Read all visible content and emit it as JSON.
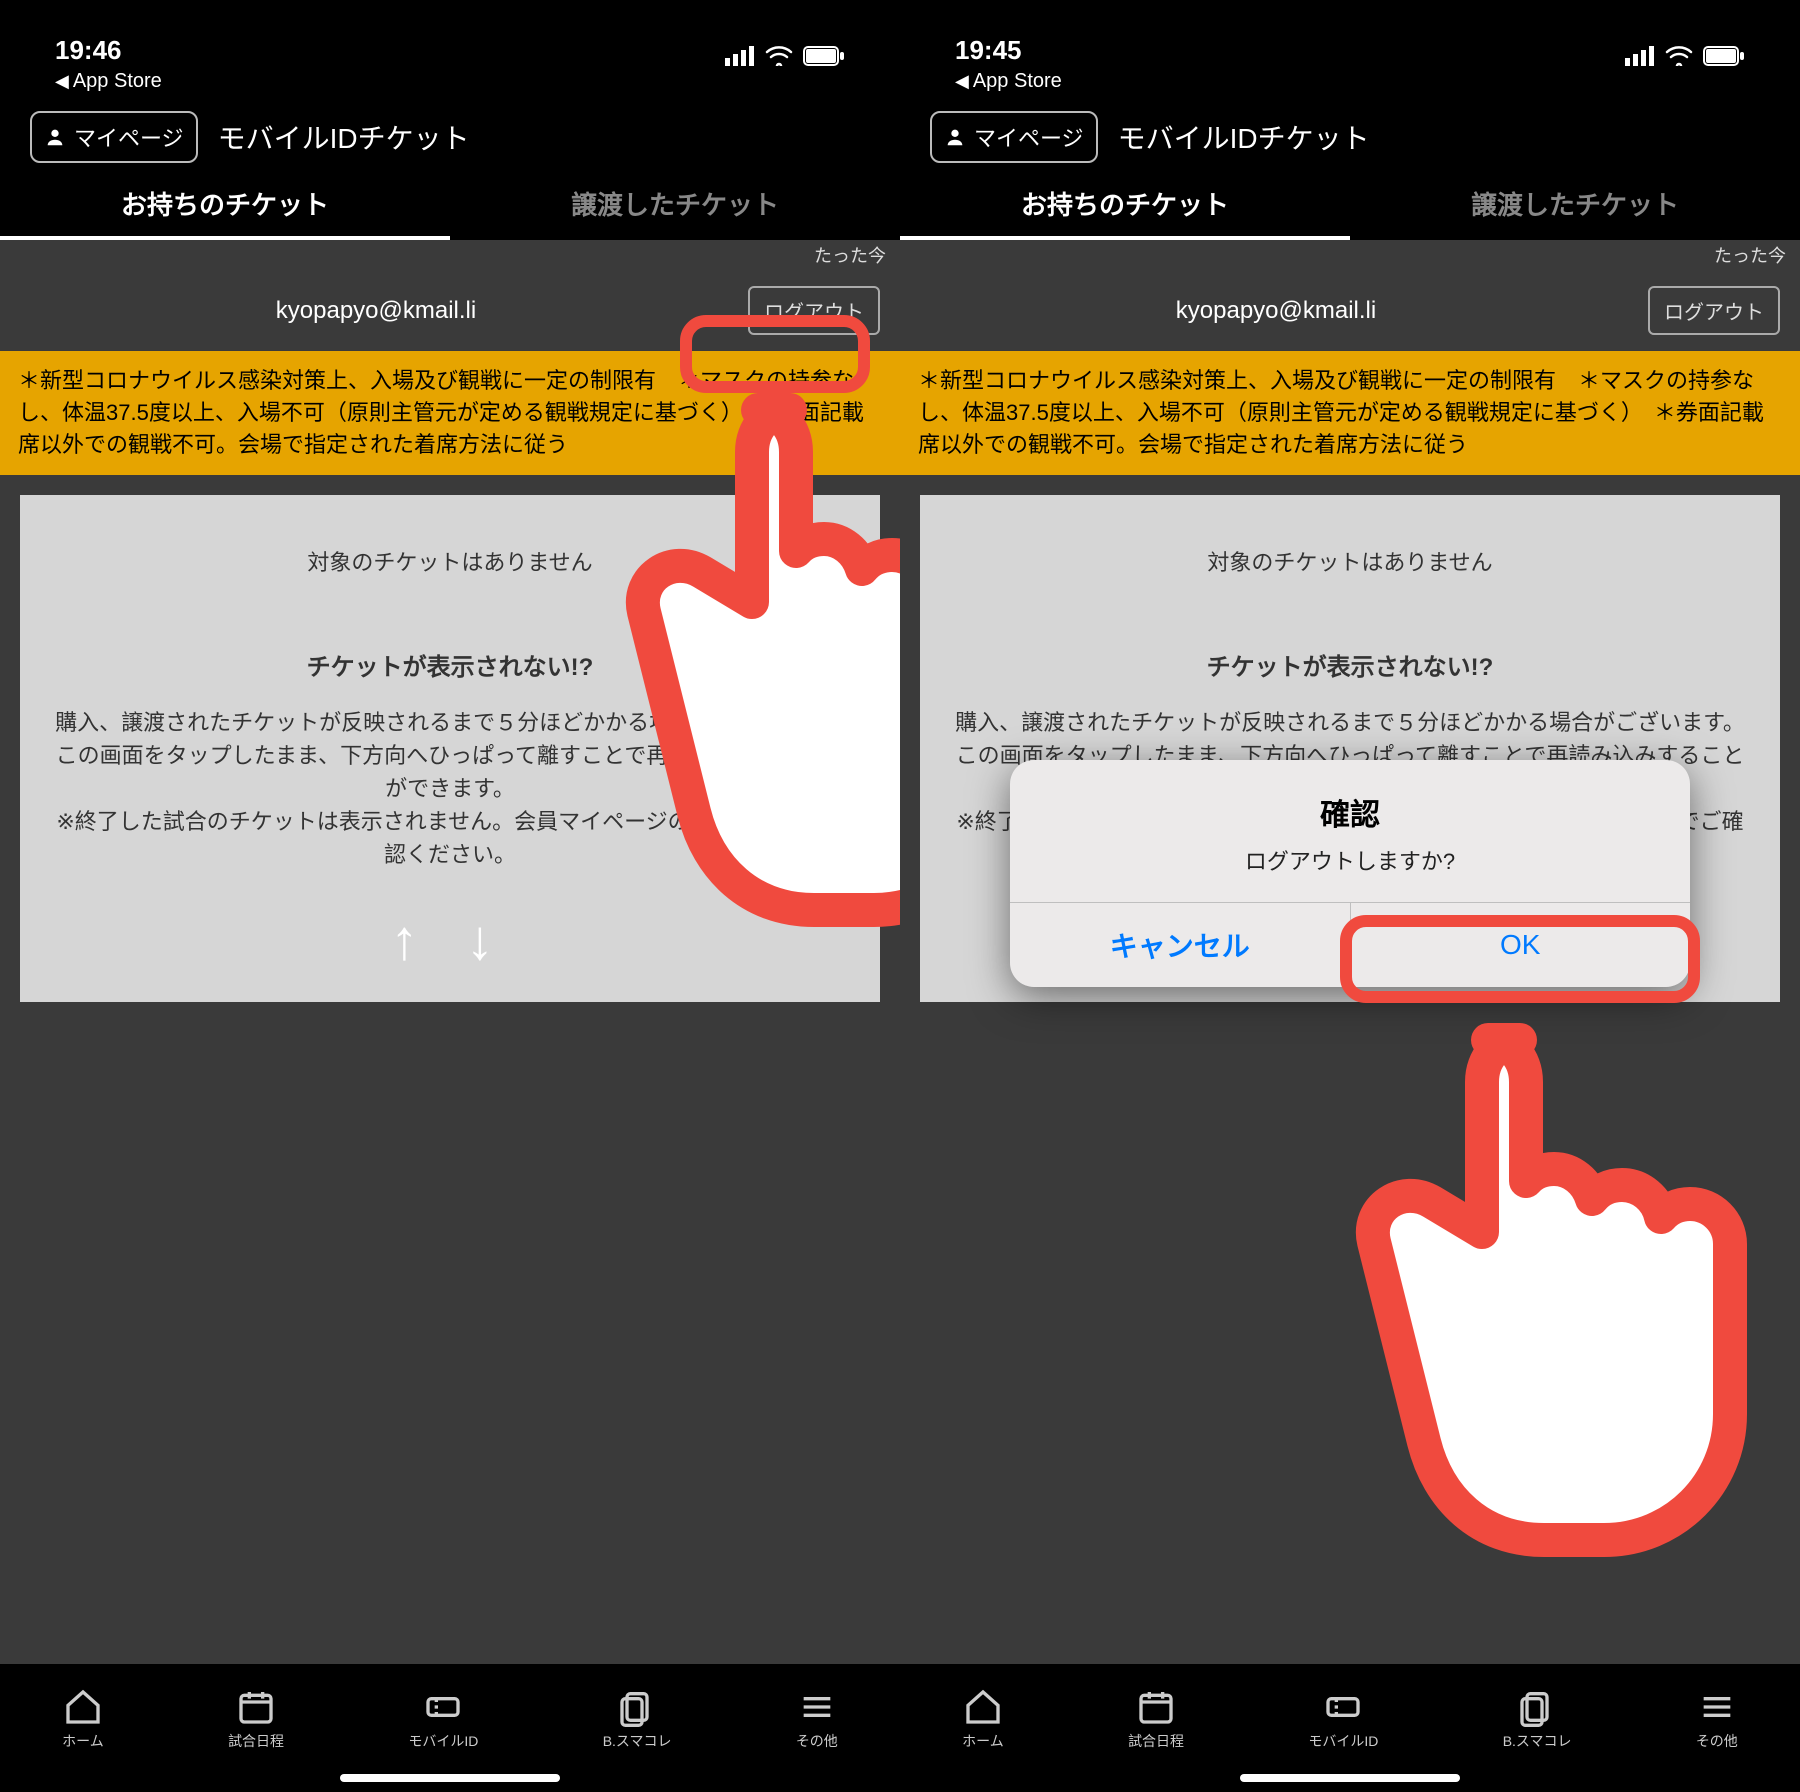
{
  "left": {
    "status": {
      "time": "19:46",
      "back_app": "App Store"
    },
    "header": {
      "mypage_label": "マイページ",
      "title": "モバイルIDチケット"
    },
    "tabs": {
      "owned": "お持ちのチケット",
      "transferred": "譲渡したチケット"
    },
    "just_now": "たった今",
    "account": {
      "email": "kyopapyo@kmail.li",
      "logout_label": "ログアウト"
    },
    "notice": "＊新型コロナウイルス感染対策上、入場及び観戦に一定の制限有　＊マスクの持参なし、体温37.5度以上、入場不可（原則主管元が定める観戦規定に基づく）　＊券面記載席以外での観戦不可。会場で指定された着席方法に従う",
    "card": {
      "no_tickets": "対象のチケットはありません",
      "help_title": "チケットが表示されない!?",
      "help_text": "購入、譲渡されたチケットが反映されるまで５分ほどかかる場合がございます。この画面をタップしたまま、下方向へひっぱって離すことで再読み込みすることができます。\n※終了した試合のチケットは表示されません。会員マイページの購入履歴でご確認ください。"
    },
    "nav": {
      "home": "ホーム",
      "schedule": "試合日程",
      "mobile_id": "モバイルID",
      "smacolle": "B.スマコレ",
      "other": "その他"
    }
  },
  "right": {
    "status": {
      "time": "19:45",
      "back_app": "App Store"
    },
    "header": {
      "mypage_label": "マイページ",
      "title": "モバイルIDチケット"
    },
    "tabs": {
      "owned": "お持ちのチケット",
      "transferred": "譲渡したチケット"
    },
    "just_now": "たった今",
    "account": {
      "email": "kyopapyo@kmail.li",
      "logout_label": "ログアウト"
    },
    "notice": "＊新型コロナウイルス感染対策上、入場及び観戦に一定の制限有　＊マスクの持参なし、体温37.5度以上、入場不可（原則主管元が定める観戦規定に基づく）　＊券面記載席以外での観戦不可。会場で指定された着席方法に従う",
    "card": {
      "no_tickets": "対象のチケットはありません",
      "help_title": "チケットが表示されない!?",
      "help_text": "購入、譲渡されたチケットが反映されるまで５分ほどかかる場合がございます。この画面をタップしたまま、下方向へひっぱって離すことで再読み込みすることができます。\n※終了した試合のチケットは表示されません。会員マイページの購入履歴でご確認ください。"
    },
    "dialog": {
      "title": "確認",
      "message": "ログアウトしますか?",
      "cancel": "キャンセル",
      "ok": "OK"
    },
    "nav": {
      "home": "ホーム",
      "schedule": "試合日程",
      "mobile_id": "モバイルID",
      "smacolle": "B.スマコレ",
      "other": "その他"
    }
  }
}
